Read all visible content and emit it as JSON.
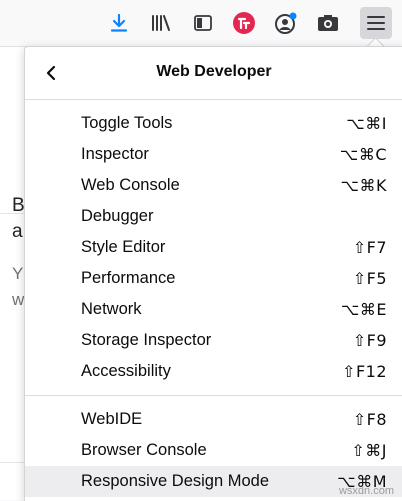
{
  "toolbar": {
    "icons": [
      "download-icon",
      "library-icon",
      "reader-view-icon",
      "addon-icon",
      "account-icon",
      "screenshot-icon",
      "hamburger-menu-icon"
    ],
    "accent": "#0a84ff",
    "addon_color": "#e22850"
  },
  "background": {
    "line1": "B",
    "line2": "a",
    "line3": "Y",
    "line4": "w"
  },
  "panel": {
    "title": "Web Developer",
    "groups": [
      [
        {
          "label": "Toggle Tools",
          "shortcut": "⌥⌘I"
        },
        {
          "label": "Inspector",
          "shortcut": "⌥⌘C"
        },
        {
          "label": "Web Console",
          "shortcut": "⌥⌘K"
        },
        {
          "label": "Debugger",
          "shortcut": ""
        },
        {
          "label": "Style Editor",
          "shortcut": "⇧F7"
        },
        {
          "label": "Performance",
          "shortcut": "⇧F5"
        },
        {
          "label": "Network",
          "shortcut": "⌥⌘E"
        },
        {
          "label": "Storage Inspector",
          "shortcut": "⇧F9"
        },
        {
          "label": "Accessibility",
          "shortcut": "⇧F12"
        }
      ],
      [
        {
          "label": "WebIDE",
          "shortcut": "⇧F8"
        },
        {
          "label": "Browser Console",
          "shortcut": "⇧⌘J"
        },
        {
          "label": "Responsive Design Mode",
          "shortcut": "⌥⌘M"
        }
      ]
    ]
  },
  "watermark": "wsxdn.com"
}
